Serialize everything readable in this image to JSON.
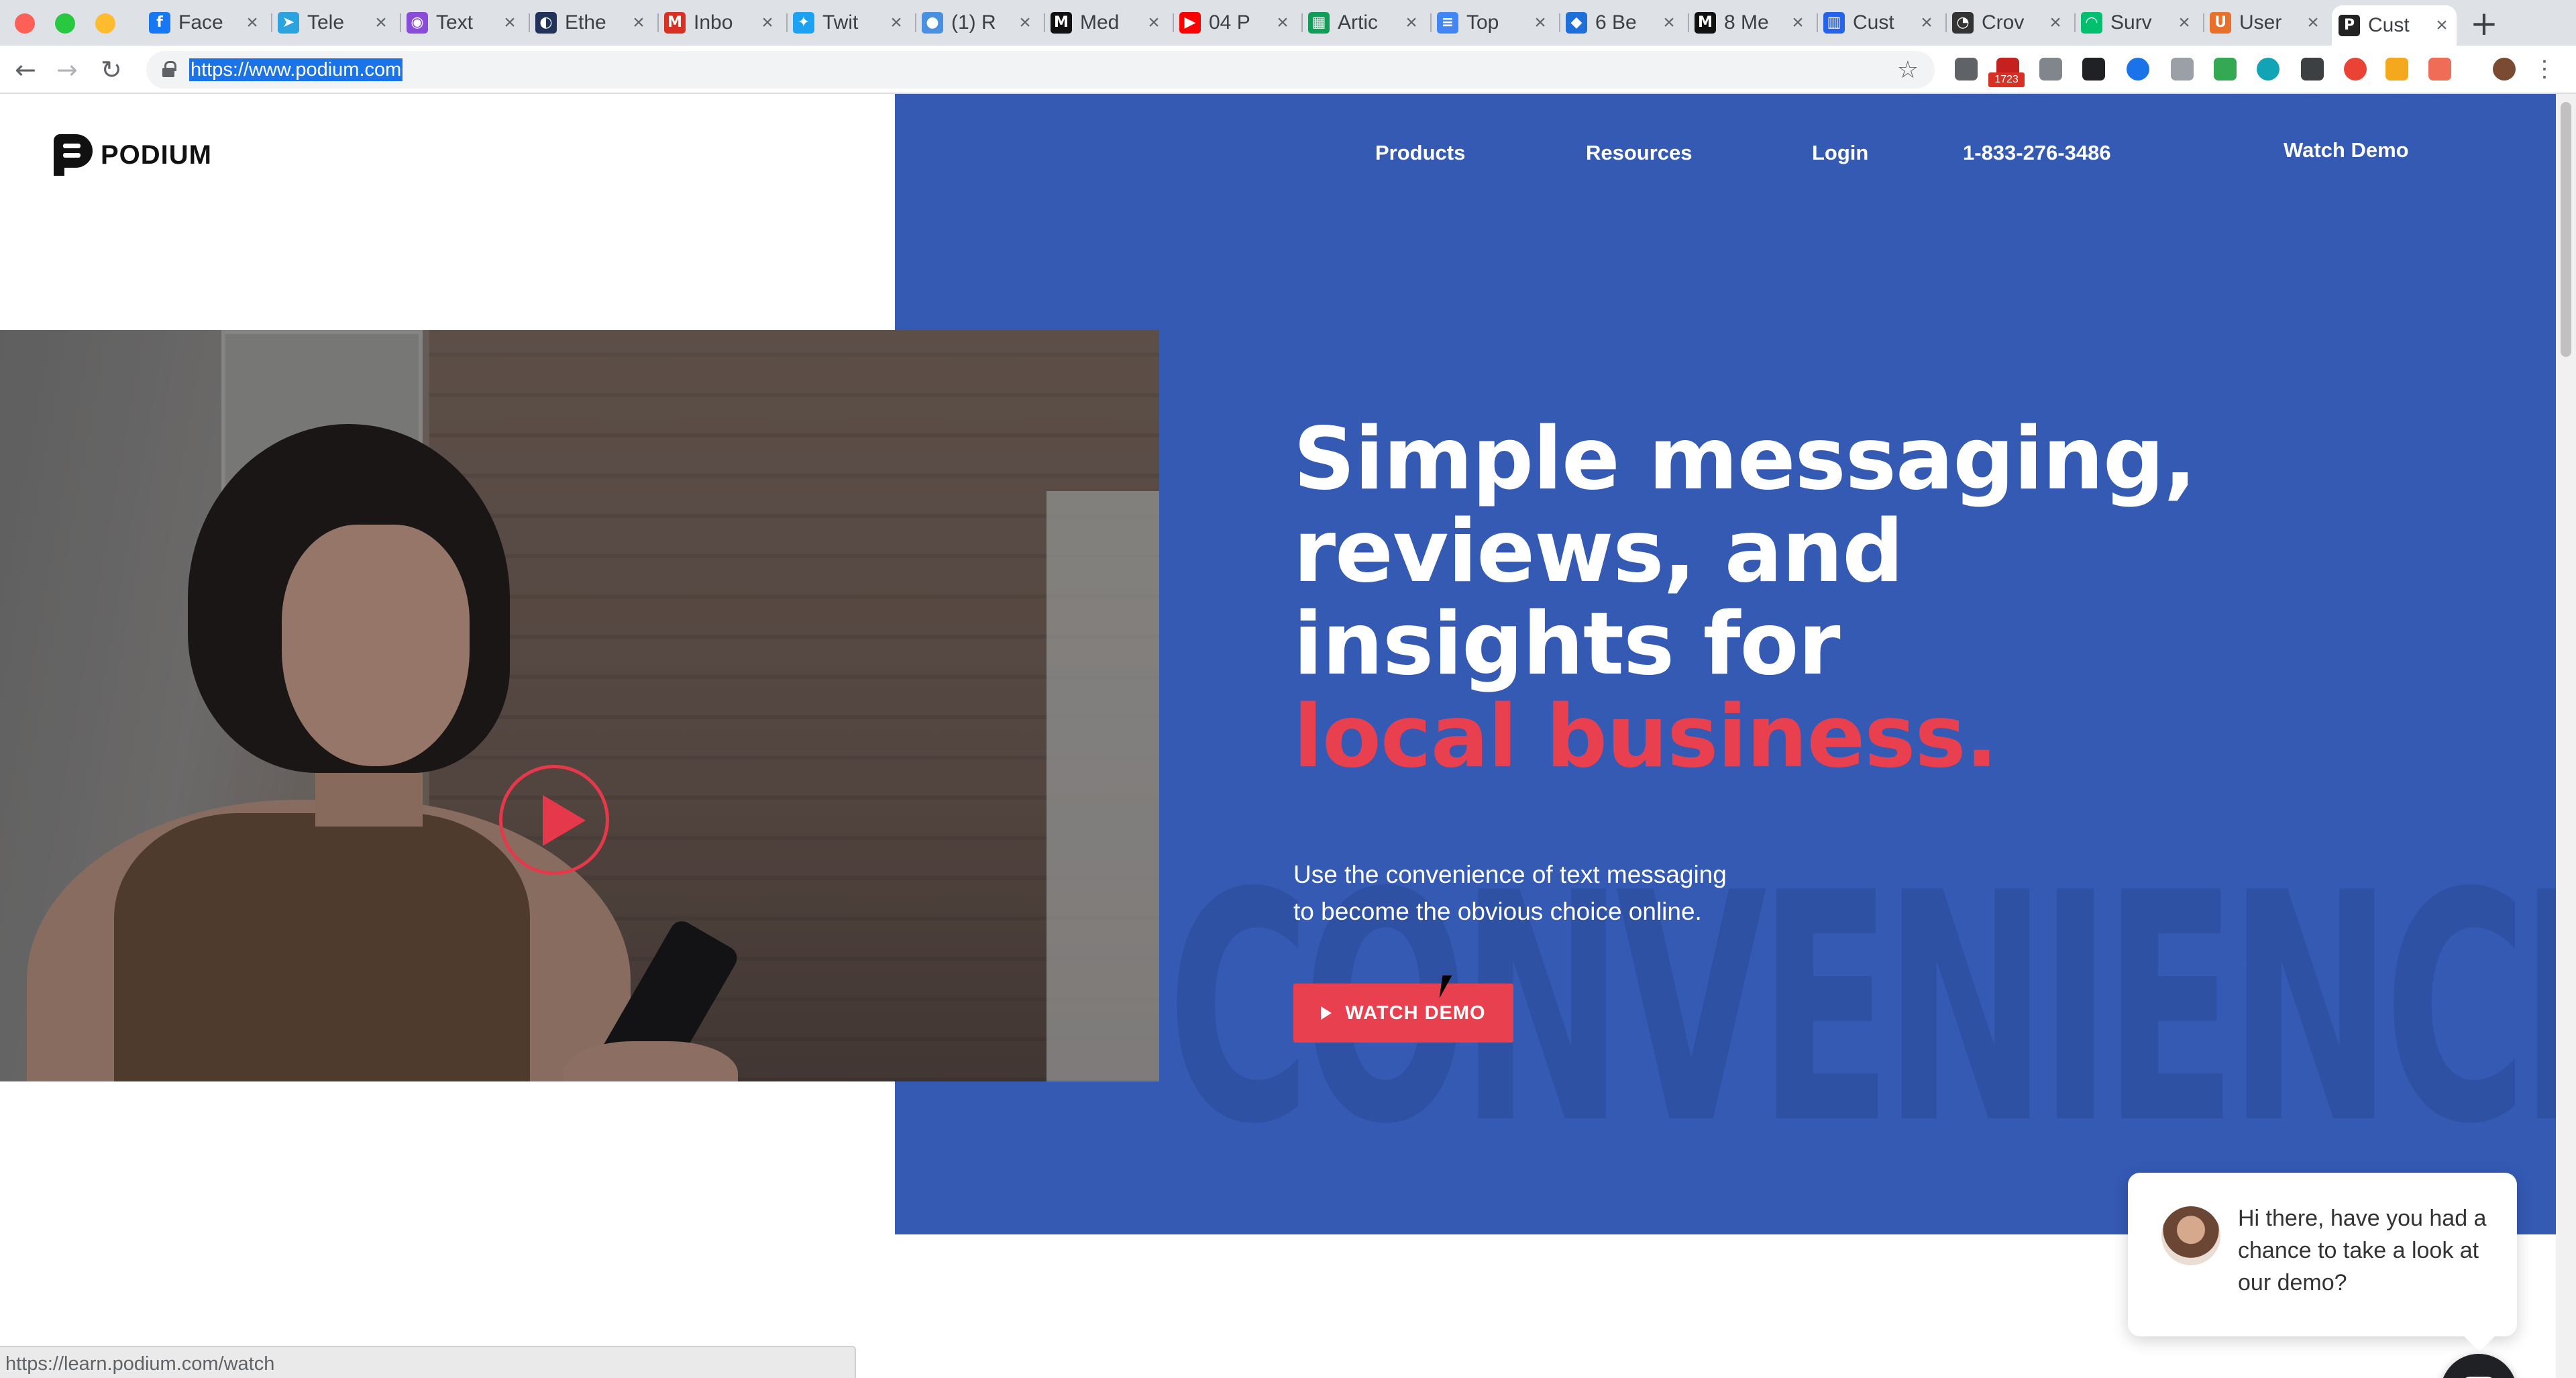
{
  "browser": {
    "tabs": [
      {
        "title": "Face",
        "icon": "facebook-icon",
        "color": "#1877f2",
        "glyph": "f"
      },
      {
        "title": "Tele",
        "icon": "telegram-icon",
        "color": "#2aa3df",
        "glyph": "➤"
      },
      {
        "title": "Text",
        "icon": "textmagic-icon",
        "color": "#8a4bd8",
        "glyph": "◉"
      },
      {
        "title": "Ethe",
        "icon": "etherscan-icon",
        "color": "#21325b",
        "glyph": "◐"
      },
      {
        "title": "Inbo",
        "icon": "gmail-icon",
        "color": "#d93025",
        "glyph": "M"
      },
      {
        "title": "Twit",
        "icon": "twitter-icon",
        "color": "#1da1f2",
        "glyph": "✦"
      },
      {
        "title": "(1) R",
        "icon": "reddit-icon",
        "color": "#4a90e2",
        "glyph": "●"
      },
      {
        "title": "Med",
        "icon": "medium-icon",
        "color": "#111111",
        "glyph": "M"
      },
      {
        "title": "04 P",
        "icon": "youtube-icon",
        "color": "#ff0000",
        "glyph": "▶"
      },
      {
        "title": "Artic",
        "icon": "sheets-icon",
        "color": "#0f9d58",
        "glyph": "▦"
      },
      {
        "title": "Top",
        "icon": "docs-icon",
        "color": "#4285f4",
        "glyph": "≡"
      },
      {
        "title": "6 Be",
        "icon": "bookmark-icon",
        "color": "#1e6fd9",
        "glyph": "◆"
      },
      {
        "title": "8 Me",
        "icon": "medium-icon",
        "color": "#111111",
        "glyph": "M"
      },
      {
        "title": "Cust",
        "icon": "intercom-icon",
        "color": "#2563eb",
        "glyph": "▥"
      },
      {
        "title": "Crov",
        "icon": "crowd-icon",
        "color": "#333333",
        "glyph": "◔"
      },
      {
        "title": "Surv",
        "icon": "surveymonkey-icon",
        "color": "#00bf6f",
        "glyph": "◠"
      },
      {
        "title": "User",
        "icon": "usertesting-icon",
        "color": "#e8702a",
        "glyph": "U"
      },
      {
        "title": "Cust",
        "icon": "podium-icon",
        "color": "#222222",
        "glyph": "P",
        "active": true
      }
    ],
    "url": "https://www.podium.com",
    "status_url": "https://learn.podium.com/watch",
    "extension_badge": "1723"
  },
  "nav": {
    "logo": "PODIUM",
    "links": [
      "Products",
      "Resources",
      "Login",
      "1-833-276-3486",
      "Watch Demo"
    ]
  },
  "hero": {
    "headline_lines": [
      "Simple messaging,",
      "reviews, and",
      "insights for"
    ],
    "headline_accent": "local business.",
    "subtext_lines": [
      "Use the convenience of text messaging",
      "to become the obvious choice online."
    ],
    "cta_label": "WATCH DEMO",
    "background_word": "CONVENIENCE"
  },
  "chat": {
    "message": "Hi there, have you had a chance to take a look at our demo?"
  },
  "colors": {
    "brand_blue": "#355ab4",
    "accent_red": "#e8404f",
    "tab_bar": "#dee1e6"
  }
}
